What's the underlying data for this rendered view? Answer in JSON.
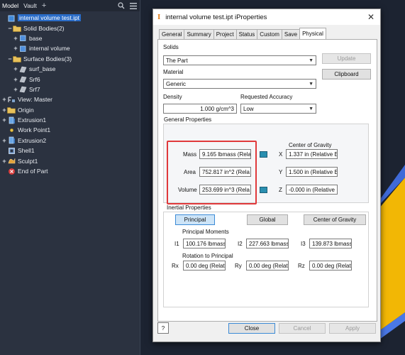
{
  "browser": {
    "tabs": [
      "Model",
      "Vault"
    ],
    "plus": "+",
    "tree": [
      {
        "label": "internal volume test.ipt",
        "indent": 0,
        "expand": "",
        "icon": "part-icon",
        "selected": true
      },
      {
        "label": "Solid Bodies(2)",
        "indent": 1,
        "expand": "−",
        "icon": "folder-icon"
      },
      {
        "label": "base",
        "indent": 2,
        "expand": "+",
        "icon": "solid-body-icon"
      },
      {
        "label": "internal volume",
        "indent": 2,
        "expand": "+",
        "icon": "solid-body-icon"
      },
      {
        "label": "Surface Bodies(3)",
        "indent": 1,
        "expand": "−",
        "icon": "folder-icon"
      },
      {
        "label": "surf_base",
        "indent": 2,
        "expand": "+",
        "icon": "surface-body-icon"
      },
      {
        "label": "Srf6",
        "indent": 2,
        "expand": "+",
        "icon": "surface-body-icon"
      },
      {
        "label": "Srf7",
        "indent": 2,
        "expand": "+",
        "icon": "surface-body-icon"
      },
      {
        "label": "View: Master",
        "indent": 0,
        "expand": "+",
        "icon": "view-icon"
      },
      {
        "label": "Origin",
        "indent": 0,
        "expand": "+",
        "icon": "folder-icon"
      },
      {
        "label": "Extrusion1",
        "indent": 0,
        "expand": "+",
        "icon": "extrusion-icon"
      },
      {
        "label": "Work Point1",
        "indent": 0,
        "expand": "",
        "icon": "work-point-icon"
      },
      {
        "label": "Extrusion2",
        "indent": 0,
        "expand": "+",
        "icon": "extrusion-icon"
      },
      {
        "label": "Shell1",
        "indent": 0,
        "expand": "",
        "icon": "shell-icon"
      },
      {
        "label": "Sculpt1",
        "indent": 0,
        "expand": "+",
        "icon": "sculpt-icon"
      },
      {
        "label": "End of Part",
        "indent": 0,
        "expand": "",
        "icon": "end-of-part-icon"
      }
    ]
  },
  "dialog": {
    "title": "internal volume test.ipt iProperties",
    "title_icon": "I",
    "close": "✕",
    "tabs": [
      "General",
      "Summary",
      "Project",
      "Status",
      "Custom",
      "Save",
      "Physical"
    ],
    "active_tab": "Physical",
    "solids_label": "Solids",
    "solids_value": "The Part",
    "update_button": "Update",
    "clipboard_button": "Clipboard",
    "material_label": "Material",
    "material_value": "Generic",
    "density_label": "Density",
    "density_value": "1.000 g/cm^3",
    "accuracy_label": "Requested Accuracy",
    "accuracy_value": "Low",
    "general_properties_title": "General Properties",
    "mass_label": "Mass",
    "mass_value": "9.165 lbmass (Rela",
    "area_label": "Area",
    "area_value": "752.817 in^2 (Rela",
    "volume_label": "Volume",
    "volume_value": "253.699 in^3 (Rela",
    "cog_title": "Center of Gravity",
    "x_label": "X",
    "x_value": "1.337 in (Relative E",
    "y_label": "Y",
    "y_value": "1.500 in (Relative E",
    "z_label": "Z",
    "z_value": "-0.000 in (Relative",
    "inertial_title": "Inertial Properties",
    "principal_button": "Principal",
    "global_button": "Global",
    "cog_button": "Center of Gravity",
    "principal_moments_label": "Principal Moments",
    "i1_label": "I1",
    "i1_value": "100.176 lbmass",
    "i2_label": "I2",
    "i2_value": "227.663 lbmass",
    "i3_label": "I3",
    "i3_value": "139.873 lbmass",
    "rotation_label": "Rotation to Principal",
    "rx_label": "Rx",
    "rx_value": "0.00 deg (Relat",
    "ry_label": "Ry",
    "ry_value": "0.00 deg (Relat",
    "rz_label": "Rz",
    "rz_value": "0.00 deg (Relat",
    "help_icon": "?",
    "close_button": "Close",
    "cancel_button": "Cancel",
    "apply_button": "Apply"
  },
  "colors": {
    "highlight_box": "#e0393b",
    "selection": "#2a6cc7",
    "model_yellow": "#f2b705",
    "model_edge_blue": "#3f6ad8"
  }
}
